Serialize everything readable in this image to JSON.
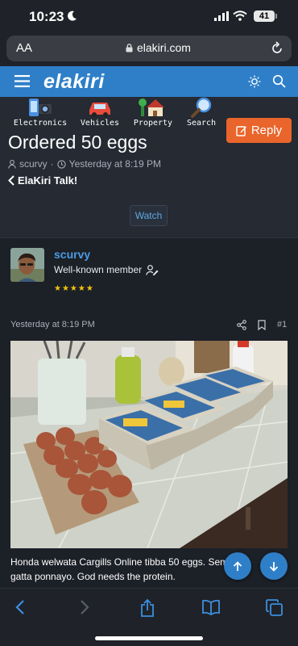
{
  "status_bar": {
    "time": "10:23",
    "battery": "41"
  },
  "browser": {
    "text_size_label": "AA",
    "url": "elakiri.com"
  },
  "site": {
    "logo": "elakiri"
  },
  "categories": [
    {
      "label": "Electronics",
      "icon": "electronics-icon"
    },
    {
      "label": "Vehicles",
      "icon": "car-icon"
    },
    {
      "label": "Property",
      "icon": "house-icon"
    },
    {
      "label": "Search",
      "icon": "magnifier-icon"
    }
  ],
  "thread": {
    "reply_label": "Reply",
    "title": "Ordered 50 eggs",
    "author": "scurvy",
    "separator": "·",
    "date": "Yesterday at 8:19 PM",
    "breadcrumb": "ElaKiri Talk!",
    "watch_label": "Watch"
  },
  "post": {
    "username": "scurvy",
    "user_title": "Well-known member",
    "rating_stars": 5,
    "timestamp": "Yesterday at 8:19 PM",
    "post_number": "#1",
    "body_line1": "Honda welwata Cargills Online tibba 50 eggs. Sema",
    "body_line2": "gatta ponnayo. God needs the protein."
  },
  "colors": {
    "accent": "#2f7fc8",
    "reply": "#e9652b",
    "username": "#4a9be3",
    "star": "#f2c40f"
  }
}
